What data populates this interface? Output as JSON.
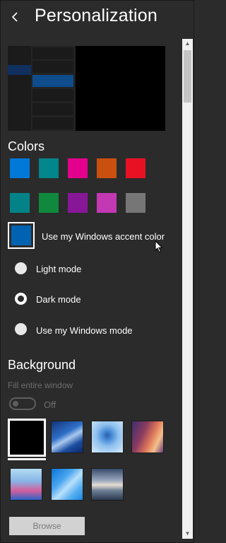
{
  "header": {
    "back_icon": "back-chevron-icon",
    "title": "Personalization"
  },
  "colors": {
    "heading": "Colors",
    "swatches": [
      "#0078d7",
      "#00868b",
      "#e3008c",
      "#ca5010",
      "#e81123",
      "#038387",
      "#10893e",
      "#881798",
      "#c239b3",
      "#767676"
    ],
    "accent_option": {
      "label": "Use my Windows accent color",
      "color": "#0063b1"
    }
  },
  "mode": {
    "options": [
      {
        "label": "Light mode",
        "selected": false
      },
      {
        "label": "Dark mode",
        "selected": true
      },
      {
        "label": "Use my Windows mode",
        "selected": false
      }
    ]
  },
  "background": {
    "heading": "Background",
    "fill_label": "Fill entire window",
    "toggle_state": "Off",
    "thumbnails": [
      "solid-black",
      "blue-streaks",
      "blue-tree",
      "canyon",
      "pink-hills",
      "blue-geometric",
      "sunset-sky"
    ],
    "browse_label": "Browse"
  }
}
